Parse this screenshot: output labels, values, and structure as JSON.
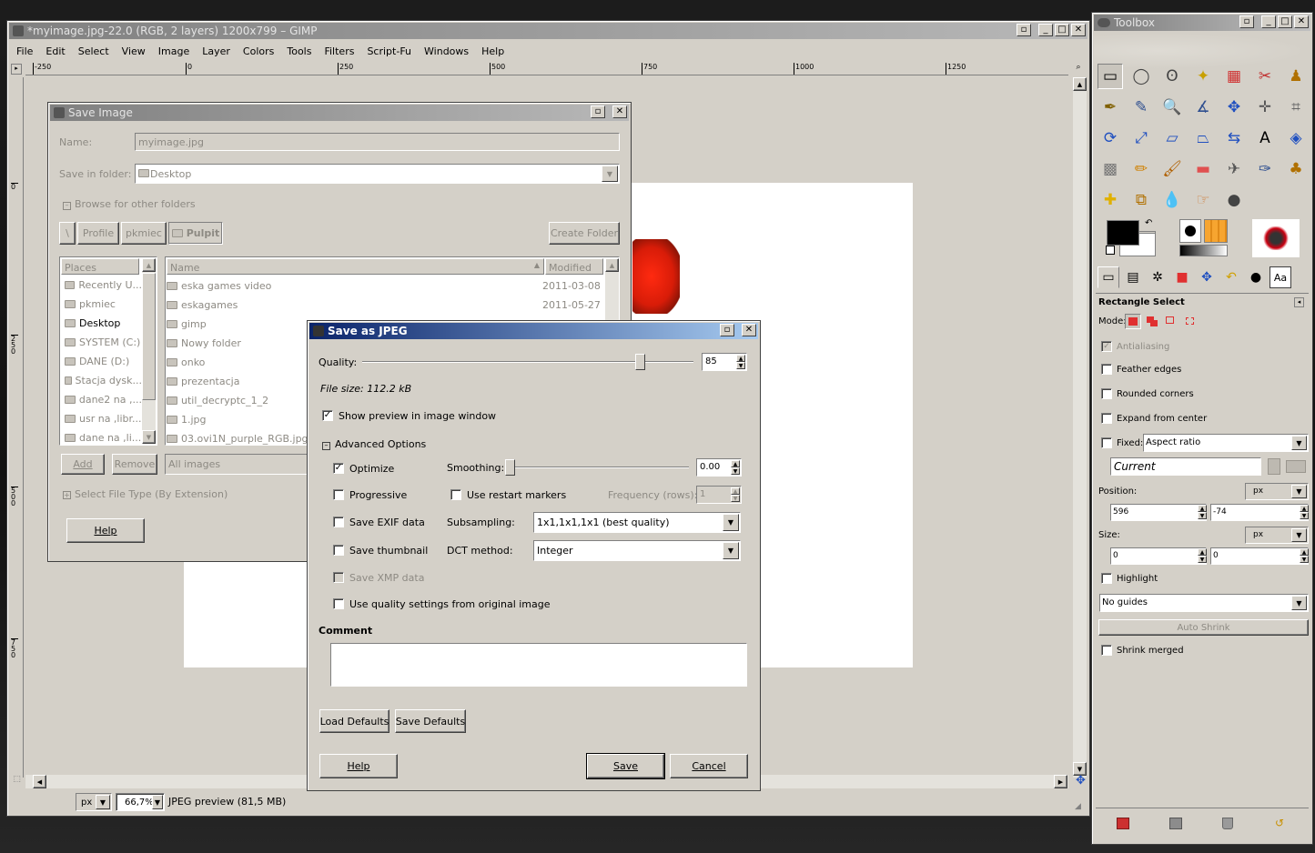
{
  "gimp": {
    "title": "*myimage.jpg-22.0 (RGB, 2 layers) 1200x799 – GIMP",
    "menu": [
      "File",
      "Edit",
      "Select",
      "View",
      "Image",
      "Layer",
      "Colors",
      "Tools",
      "Filters",
      "Script-Fu",
      "Windows",
      "Help"
    ],
    "ruler_h": [
      "-250",
      "0",
      "250",
      "500",
      "750",
      "1000",
      "1250"
    ],
    "ruler_v": [
      "0",
      "250",
      "500",
      "750"
    ],
    "status": {
      "unit": "px",
      "zoom": "66,7%",
      "message": "JPEG preview (81,5 MB)"
    }
  },
  "save_image": {
    "title": "Save Image",
    "name_label": "Name:",
    "name_value": "myimage.jpg",
    "folder_label": "Save in folder:",
    "folder_value": "Desktop",
    "browse": "Browse for other folders",
    "path_buttons": [
      "\\",
      "Profile",
      "pkmiec",
      "Pulpit"
    ],
    "create_folder": "Create Folder",
    "places_header": "Places",
    "places": [
      "Recently U...",
      "pkmiec",
      "Desktop",
      "SYSTEM (C:)",
      "DANE (D:)",
      "Stacja dysk...",
      "dane2 na ,...",
      "usr na ,libr...",
      "dane na ,li..."
    ],
    "name_header": "Name",
    "modified_header": "Modified",
    "files": [
      {
        "name": "eska games video",
        "date": "2011-03-08"
      },
      {
        "name": "eskagames",
        "date": "2011-05-27"
      },
      {
        "name": "gimp",
        "date": ""
      },
      {
        "name": "Nowy folder",
        "date": ""
      },
      {
        "name": "onko",
        "date": ""
      },
      {
        "name": "prezentacja",
        "date": ""
      },
      {
        "name": "util_decryptc_1_2",
        "date": ""
      },
      {
        "name": "1.jpg",
        "date": ""
      },
      {
        "name": "03.ovi1N_purple_RGB.jpg",
        "date": ""
      }
    ],
    "add": "Add",
    "remove": "Remove",
    "filter": "All images",
    "file_type": "Select File Type (By Extension)",
    "help": "Help"
  },
  "jpeg": {
    "title": "Save as JPEG",
    "quality_label": "Quality:",
    "quality_value": "85",
    "quality_fraction": 0.85,
    "file_size": "File size: 112.2 kB",
    "show_preview": "Show preview in image window",
    "advanced": "Advanced Options",
    "optimize": "Optimize",
    "smoothing_label": "Smoothing:",
    "smoothing_value": "0.00",
    "progressive": "Progressive",
    "restart_markers": "Use restart markers",
    "frequency_label": "Frequency (rows):",
    "frequency_value": "1",
    "save_exif": "Save EXIF data",
    "subsampling_label": "Subsampling:",
    "subsampling_value": "1x1,1x1,1x1 (best quality)",
    "save_thumbnail": "Save thumbnail",
    "dct_label": "DCT method:",
    "dct_value": "Integer",
    "save_xmp": "Save XMP data",
    "use_quality": "Use quality settings from original image",
    "comment_label": "Comment",
    "load_defaults": "Load Defaults",
    "save_defaults": "Save Defaults",
    "help": "Help",
    "save": "Save",
    "cancel": "Cancel"
  },
  "toolbox": {
    "title": "Toolbox",
    "tool_name": "Rectangle Select",
    "mode_label": "Mode:",
    "antialiasing": "Antialiasing",
    "feather": "Feather edges",
    "rounded": "Rounded corners",
    "expand": "Expand from center",
    "fixed": "Fixed:",
    "fixed_value": "Aspect ratio",
    "current": "Current",
    "position_label": "Position:",
    "pos_unit": "px",
    "pos_x": "596",
    "pos_y": "-74",
    "size_label": "Size:",
    "size_unit": "px",
    "size_w": "0",
    "size_h": "0",
    "highlight": "Highlight",
    "guides": "No guides",
    "auto_shrink": "Auto Shrink",
    "shrink_merged": "Shrink merged",
    "foreground": "#000000",
    "background": "#ffffff"
  }
}
